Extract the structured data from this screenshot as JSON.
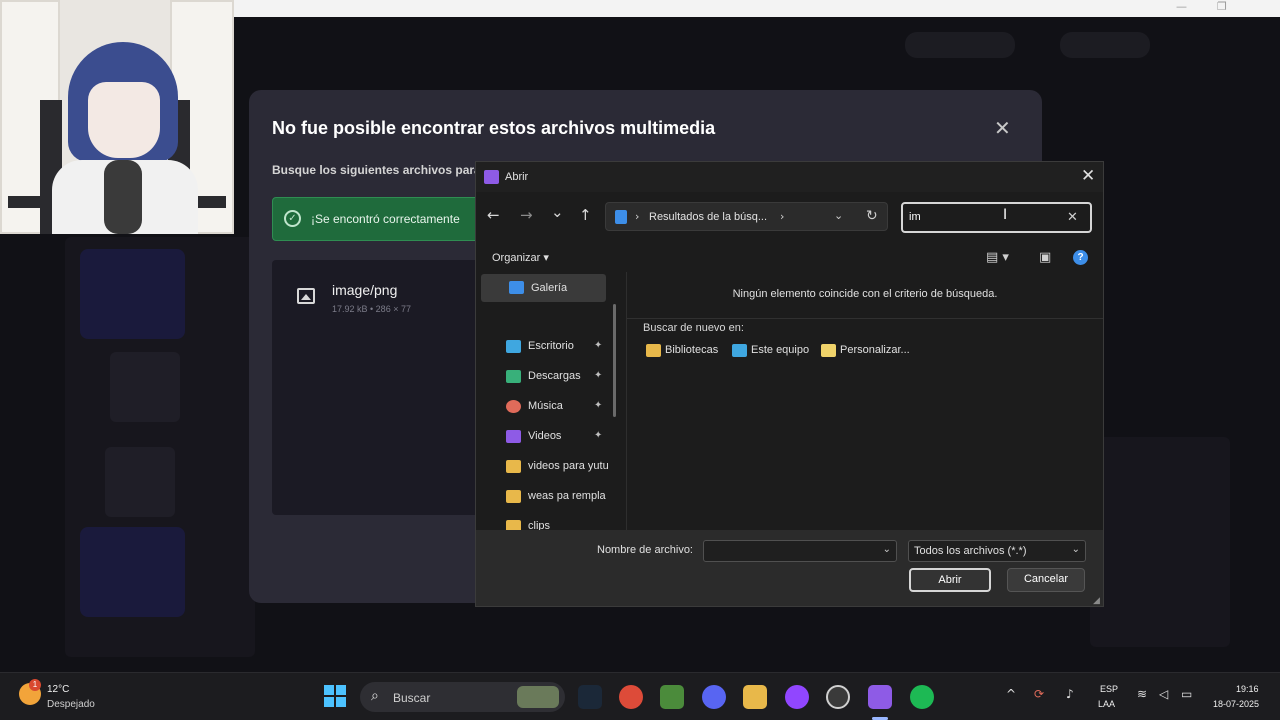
{
  "media_dialog": {
    "title": "No fue posible encontrar estos archivos multimedia",
    "close_glyph": "✕",
    "subtitle": "Busque los siguientes archivos para",
    "success_message": "¡Se encontró correctamente",
    "file": {
      "type": "image/png",
      "meta": "17.92 kB • 286 × 77"
    }
  },
  "open_dialog": {
    "title": "Abrir",
    "close_glyph": "✕",
    "nav": {
      "back": "←",
      "forward": "→",
      "recent": "⌄",
      "up": "↑"
    },
    "address_path": "Resultados de la búsq...",
    "search_value": "im",
    "organize_label": "Organizar ▾",
    "quick_access": [
      {
        "label": "Galería",
        "icon": "gallery-icon",
        "color": "#3d8ee8"
      },
      {
        "label": "Escritorio",
        "icon": "desktop-icon",
        "color": "#3fa7e0"
      },
      {
        "label": "Descargas",
        "icon": "download-icon",
        "color": "#38b07a"
      },
      {
        "label": "Música",
        "icon": "music-icon",
        "color": "#e06b5a"
      },
      {
        "label": "Videos",
        "icon": "video-icon",
        "color": "#8e5be6"
      },
      {
        "label": "videos para yutu",
        "icon": "folder-icon",
        "color": "#e8b84a"
      },
      {
        "label": "weas pa rempla",
        "icon": "folder-icon",
        "color": "#e8b84a"
      },
      {
        "label": "clips",
        "icon": "folder-icon",
        "color": "#e8b84a"
      }
    ],
    "no_items_message": "Ningún elemento coincide con el criterio de búsqueda.",
    "search_again_label": "Buscar de nuevo en:",
    "search_again_links": [
      {
        "label": "Bibliotecas",
        "icon": "libraries-icon",
        "color": "#e8b84a"
      },
      {
        "label": "Este equipo",
        "icon": "computer-icon",
        "color": "#3fa7e0"
      },
      {
        "label": "Personalizar...",
        "icon": "custom-folder-icon",
        "color": "#f0d36a"
      }
    ],
    "file_name_label": "Nombre de archivo:",
    "file_name_value": "",
    "filter_value": "Todos los archivos (*.*)",
    "open_button": "Abrir",
    "cancel_button": "Cancelar"
  },
  "taskbar": {
    "weather_temp": "12°C",
    "weather_desc": "Despejado",
    "weather_badge": "1",
    "search_placeholder": "Buscar",
    "apps": [
      {
        "name": "steam-icon",
        "color": "#1b2838"
      },
      {
        "name": "chrome-icon",
        "color": "#dd4b39"
      },
      {
        "name": "minecraft-icon",
        "color": "#4b8b3b"
      },
      {
        "name": "discord-icon",
        "color": "#5865f2"
      },
      {
        "name": "file-explorer-icon",
        "color": "#e8b84a"
      },
      {
        "name": "twitch-icon",
        "color": "#9146ff"
      },
      {
        "name": "obs-icon",
        "color": "#3a3a3a"
      },
      {
        "name": "clipchamp-icon",
        "color": "#8e5be6"
      },
      {
        "name": "spotify-icon",
        "color": "#1db954"
      }
    ],
    "language": "ESP",
    "keyboard_layout": "LAA",
    "time": "19:16",
    "date": "18-07-2025"
  }
}
